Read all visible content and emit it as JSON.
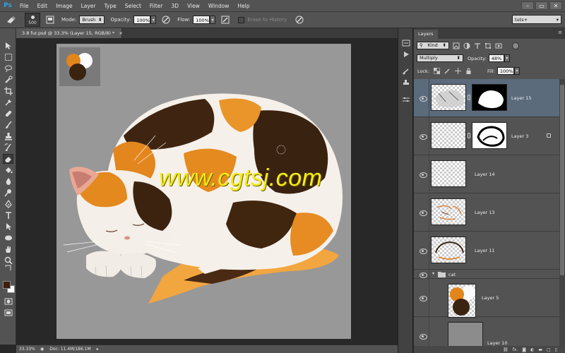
{
  "app": {
    "logo": "Ps"
  },
  "menu": [
    "File",
    "Edit",
    "Image",
    "Layer",
    "Type",
    "Select",
    "Filter",
    "3D",
    "View",
    "Window",
    "Help"
  ],
  "window_controls": [
    "–",
    "▭",
    "✕"
  ],
  "options": {
    "brush_size": "500",
    "mode_label": "Mode:",
    "mode_value": "Brush",
    "opacity_label": "Opacity:",
    "opacity_value": "100%",
    "flow_label": "Flow:",
    "flow_value": "100%",
    "erase_history_label": "Erase to History",
    "workspace": "tuts+"
  },
  "document": {
    "tab_title": "3.8 fur.psd @ 33.3% (Layer 15, RGB/8) *",
    "close": "×",
    "watermark": "www.cgtsj.com"
  },
  "status": {
    "zoom": "33.33%",
    "doc_size": "Doc: 11.4M/186.1M"
  },
  "layers_panel": {
    "tab_label": "Layers",
    "filter_label": "Kind",
    "blend_mode": "Multiply",
    "opacity_label": "Opacity:",
    "opacity_value": "48%",
    "lock_label": "Lock:",
    "fill_label": "Fill:",
    "fill_value": "100%",
    "layers": [
      {
        "name": "Layer 15",
        "selected": true,
        "has_mask": true
      },
      {
        "name": "Layer 3",
        "selected": false,
        "has_mask": true,
        "locked": true
      },
      {
        "name": "Layer 14",
        "selected": false,
        "has_mask": false
      },
      {
        "name": "Layer 13",
        "selected": false,
        "has_mask": false
      },
      {
        "name": "Layer 11",
        "selected": false,
        "has_mask": false
      }
    ],
    "group_name": "cat",
    "group_layers": [
      {
        "name": "Layer 5"
      },
      {
        "name": "Layer 10"
      }
    ],
    "footer_icons": [
      "link-icon",
      "fx-icon",
      "mask-icon",
      "adjustment-icon",
      "folder-icon",
      "new-layer-icon",
      "trash-icon"
    ],
    "footer_fx": "fx."
  },
  "colors": {
    "foreground": "#3b1f0c",
    "background": "#ffffff",
    "watermark": "#f6ec12",
    "selected_layer": "#5b6b7c"
  }
}
